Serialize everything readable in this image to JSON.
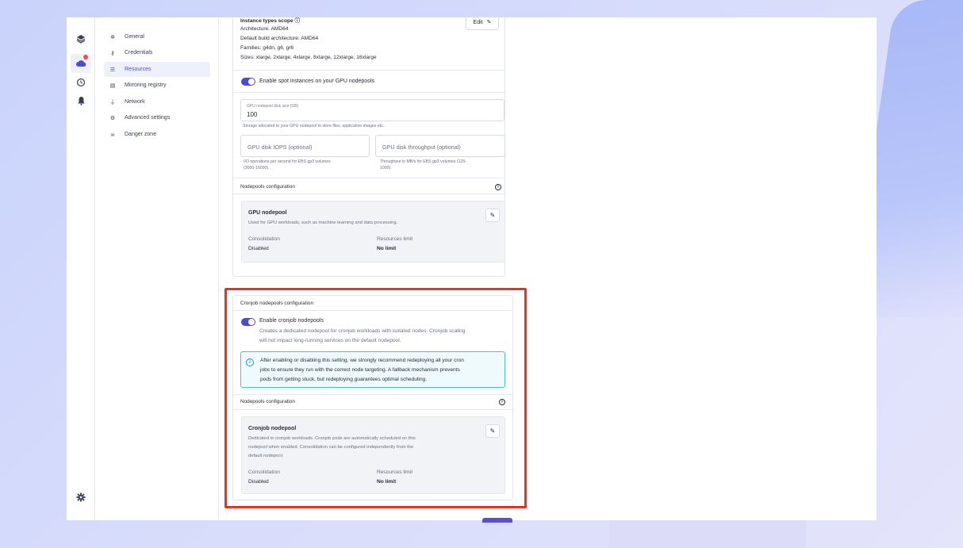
{
  "submenu": {
    "items": [
      {
        "label": "General",
        "icon": "gear-icon"
      },
      {
        "label": "Credentials",
        "icon": "key-icon"
      },
      {
        "label": "Resources",
        "icon": "sliders-icon"
      },
      {
        "label": "Mirroring registry",
        "icon": "archive-icon"
      },
      {
        "label": "Network",
        "icon": "plug-icon"
      },
      {
        "label": "Advanced settings",
        "icon": "cogs-icon"
      },
      {
        "label": "Danger zone",
        "icon": "skull-icon"
      }
    ]
  },
  "instance": {
    "scope_title": "Instance types scope ⓘ",
    "architecture": "Architecture: AMD64",
    "default_build": "Default build architecture: AMD64",
    "families": "Families: g4dn, g6, gr6",
    "sizes": "Sizes: xlarge, 2xlarge, 4xlarge, 8xlarge, 12xlarge, 16xlarge",
    "edit_label": "Edit"
  },
  "spot": {
    "label": "Enable spot instances on your GPU nodepools"
  },
  "disk": {
    "label": "GPU nodepool disk size (GB)",
    "value": "100",
    "help": "Storage allocated to your GPU nodepool to store files, application images etc.."
  },
  "iops": {
    "placeholder": "GPU disk IOPS (optional)",
    "help_line1": "I/O operations per second for EBS gp3 volumes",
    "help_line2": "(3000-16000)."
  },
  "throughput": {
    "placeholder": "GPU disk throughput (optional)",
    "help_line1": "Throughput in MB/s for EBS gp3 volumes (125-",
    "help_line2": "1000)."
  },
  "gpu_nodepools": {
    "section_title": "Nodepools configuration",
    "name": "GPU nodepool",
    "description": "Used for GPU workloads, such as machine learning and data processing.",
    "consolidation_label": "Consolidation",
    "consolidation_value": "Disabled",
    "resources_label": "Resources limit",
    "resources_value": "No limit"
  },
  "cronjob": {
    "card_title": "Cronjob nodepools configuration",
    "toggle_label": "Enable cronjob nodepools",
    "toggle_desc_line1": "Creates a dedicated nodepool for cronjob workloads with isolated nodes. Cronjob scaling",
    "toggle_desc_line2": "will not impact long-running services on the default nodepool.",
    "alert_line1": "After enabling or disabling this setting, we strongly recommend redeploying all your cron",
    "alert_line2": "jobs to ensure they run with the correct node targeting. A fallback mechanism prevents",
    "alert_line3": "pods from getting stuck, but redeploying guarantees optimal scheduling.",
    "section_title": "Nodepools configuration",
    "name": "Cronjob nodepool",
    "desc_line1": "Dedicated to cronjob workloads. Cronjob pods are automatically scheduled on this",
    "desc_line2": "nodepool when enabled. Consolidation can be configured independently from the",
    "desc_line3": "default nodepool.",
    "consolidation_label": "Consolidation",
    "consolidation_value": "Disabled",
    "resources_label": "Resources limit",
    "resources_value": "No limit"
  },
  "colors": {
    "accent": "#4b4ec9",
    "highlight": "#e8321f",
    "alert_border": "#45c2d6"
  }
}
